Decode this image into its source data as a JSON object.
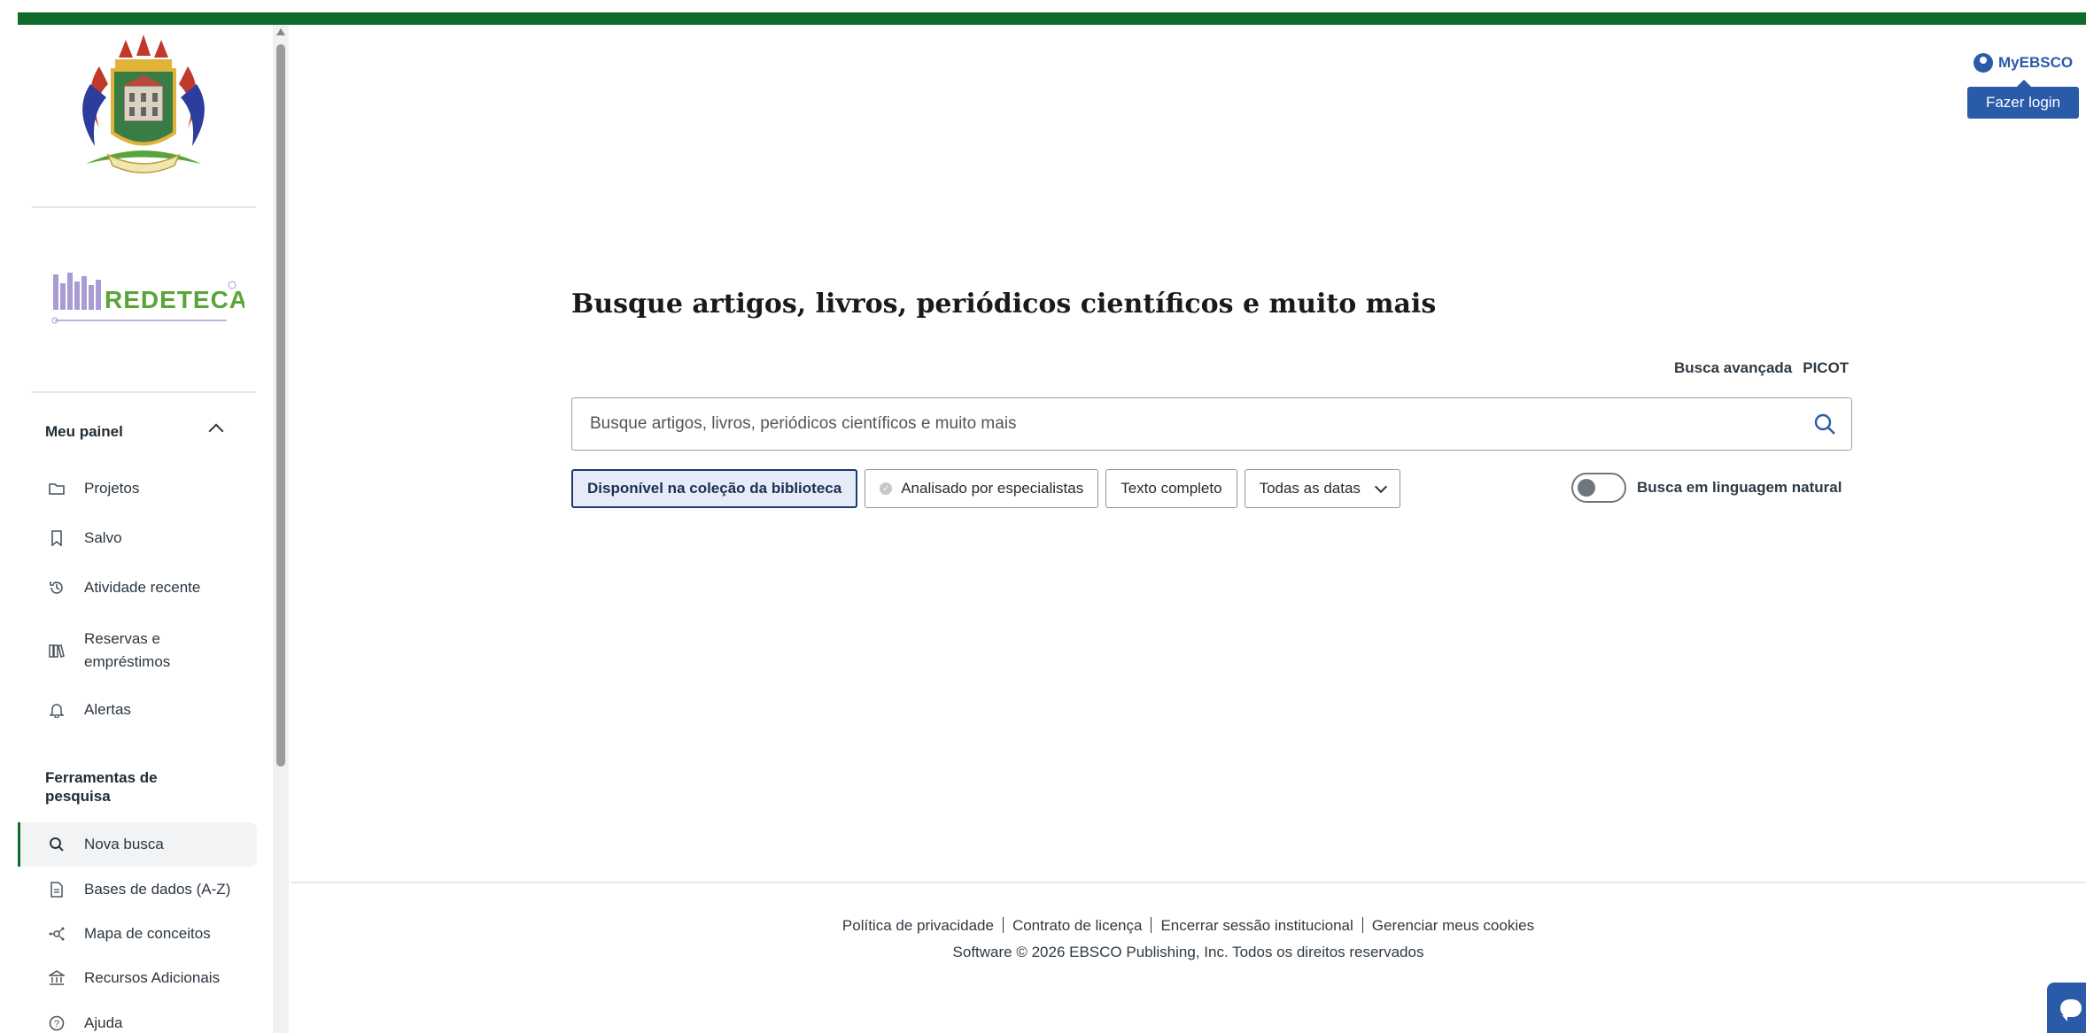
{
  "header": {
    "myebsco_label": "MyEBSCO",
    "login_tooltip": "Fazer login",
    "brand_color": "#0f6b2c",
    "accent_color": "#2a5ba8"
  },
  "sidebar": {
    "logos": [
      "university-crest-logo",
      "redeteca-logo"
    ],
    "panel_heading": "Meu painel",
    "panel_items": [
      {
        "label": "Projetos",
        "icon": "folder-icon"
      },
      {
        "label": "Salvo",
        "icon": "bookmark-icon"
      },
      {
        "label": "Atividade recente",
        "icon": "history-icon"
      },
      {
        "label": "Reservas e empréstimos",
        "icon": "books-icon"
      },
      {
        "label": "Alertas",
        "icon": "bell-icon"
      }
    ],
    "tools_heading": "Ferramentas de pesquisa",
    "tools_items": [
      {
        "label": "Nova busca",
        "icon": "search-icon",
        "active": true
      },
      {
        "label": "Bases de dados (A-Z)",
        "icon": "document-icon"
      },
      {
        "label": "Mapa de conceitos",
        "icon": "concept-map-icon"
      },
      {
        "label": "Recursos Adicionais",
        "icon": "institution-icon"
      },
      {
        "label": "Ajuda",
        "icon": "help-icon"
      }
    ]
  },
  "main": {
    "headline": "Busque artigos, livros, periódicos científicos e muito mais",
    "advanced_search": "Busca avançada",
    "picot": "PICOT",
    "search_placeholder": "Busque artigos, livros, periódicos científicos e muito mais",
    "filters": {
      "library_collection": "Disponível na coleção da biblioteca",
      "peer_reviewed": "Analisado por especialistas",
      "full_text": "Texto completo",
      "dates": "Todas as datas"
    },
    "natural_language_label": "Busca em linguagem natural",
    "natural_language_on": false
  },
  "footer": {
    "privacy": "Política de privacidade",
    "license": "Contrato de licença",
    "end_session": "Encerrar sessão institucional",
    "cookies": "Gerenciar meus cookies",
    "copyright": "Software © 2026 EBSCO Publishing, Inc. Todos os direitos reservados"
  }
}
